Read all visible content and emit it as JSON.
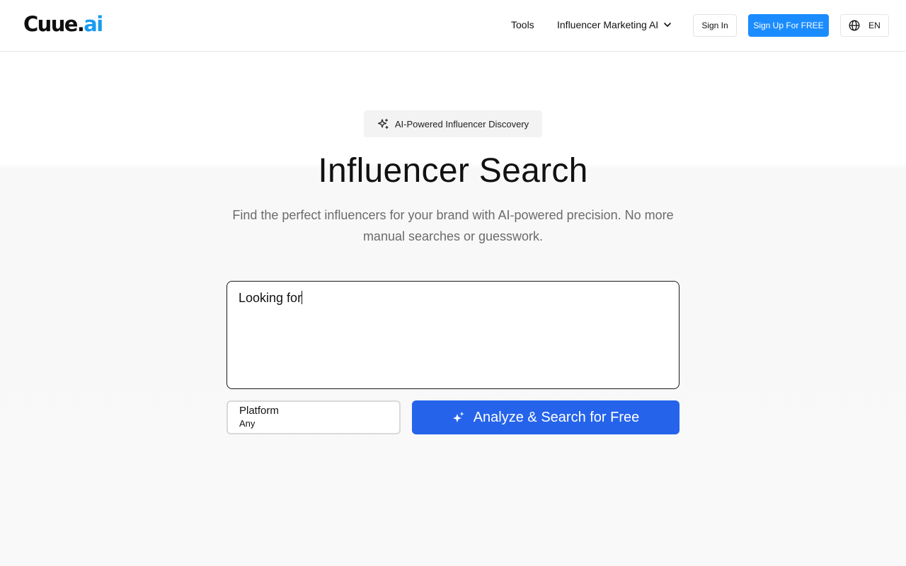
{
  "header": {
    "logo": {
      "part1": "Cuue.",
      "part2": "ai"
    },
    "nav": {
      "tools": "Tools",
      "influencer_ai": "Influencer Marketing AI"
    },
    "sign_in": "Sign In",
    "sign_up": "Sign Up For FREE",
    "language": "EN"
  },
  "hero": {
    "badge": "AI-Powered Influencer Discovery",
    "title": "Influencer Search",
    "subtitle": "Find the perfect influencers for your brand with AI-powered precision. No more manual searches or guesswork."
  },
  "search": {
    "placeholder": "Looking for"
  },
  "platform": {
    "label": "Platform",
    "value": "Any"
  },
  "analyze_button": {
    "label": "Analyze & Search for Free"
  },
  "colors": {
    "brand_blue": "#1a8cff",
    "button_blue": "#2563eb",
    "logo_accent": "#1a9bf0"
  }
}
